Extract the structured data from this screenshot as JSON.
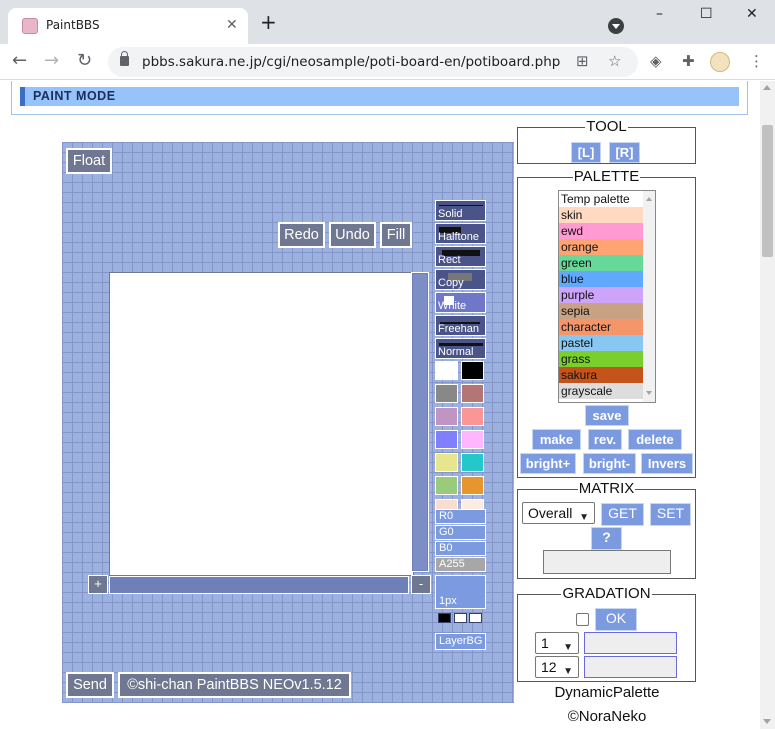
{
  "browser": {
    "tab_title": "PaintBBS",
    "tab_close": "✕",
    "new_tab": "+",
    "url": "pbbs.sakura.ne.jp/cgi/neosample/poti-board-en/potiboard.php",
    "win_min": "–",
    "win_max": "☐",
    "win_close": "✕",
    "back": "←",
    "forward": "→",
    "reload": "↻",
    "translate": "⊞",
    "star": "☆",
    "shield": "◈",
    "puzzle": "✚",
    "menu": "⋮"
  },
  "page": {
    "mode_title": "PAINT MODE"
  },
  "applet": {
    "float": "Float",
    "redo": "Redo",
    "undo": "Undo",
    "fill": "Fill",
    "plus": "+",
    "minus": "-",
    "send": "Send",
    "copyright": "©shi-chan PaintBBS NEOv1.5.12",
    "tools": [
      "Solid",
      "Halftone",
      "Rect",
      "Copy",
      "White",
      "Freehan",
      "Normal"
    ],
    "swatches": [
      [
        "#ffffff",
        "#000000"
      ],
      [
        "#888888",
        "#b47575"
      ],
      [
        "#c095c2",
        "#fa9696"
      ],
      [
        "#8080ff",
        "#ffb6ff"
      ],
      [
        "#e7e58d",
        "#25c7c9"
      ],
      [
        "#99cb7b",
        "#e7962d"
      ],
      [
        "#f9ddcf",
        "#fcece2"
      ]
    ],
    "rgb": {
      "r": "R0",
      "g": "G0",
      "b": "B0",
      "a": "A255"
    },
    "size": "1px",
    "layer": "LayerBG"
  },
  "tool_panel": {
    "legend": "TOOL",
    "left": "[L]",
    "right": "[R]"
  },
  "palette_panel": {
    "legend": "PALETTE",
    "items": [
      {
        "label": "Temp palette",
        "color": "#ffffff"
      },
      {
        "label": "skin",
        "color": "#ffd9c0"
      },
      {
        "label": "ewd",
        "color": "#ff9ad2"
      },
      {
        "label": "orange",
        "color": "#ffa372"
      },
      {
        "label": "green",
        "color": "#66d99a"
      },
      {
        "label": "blue",
        "color": "#61a8ff"
      },
      {
        "label": "purple",
        "color": "#cda4fa"
      },
      {
        "label": "sepia",
        "color": "#c9a183"
      },
      {
        "label": "character",
        "color": "#f4966a"
      },
      {
        "label": "pastel",
        "color": "#87c7f2"
      },
      {
        "label": "grass",
        "color": "#7bcf2d"
      },
      {
        "label": "sakura",
        "color": "#c4541c"
      },
      {
        "label": "grayscale",
        "color": "#dddddd"
      }
    ],
    "save": "save",
    "make": "make",
    "rev": "rev.",
    "delete": "delete",
    "bright_plus": "bright+",
    "bright_minus": "bright-",
    "invers": "Invers"
  },
  "matrix_panel": {
    "legend": "MATRIX",
    "select": "Overall",
    "get": "GET",
    "set": "SET",
    "help": "?"
  },
  "gradation_panel": {
    "legend": "GRADATION",
    "ok": "OK",
    "select1": "1",
    "select2": "12"
  },
  "credits": {
    "line1": "DynamicPalette",
    "line2": "©NoraNeko"
  }
}
